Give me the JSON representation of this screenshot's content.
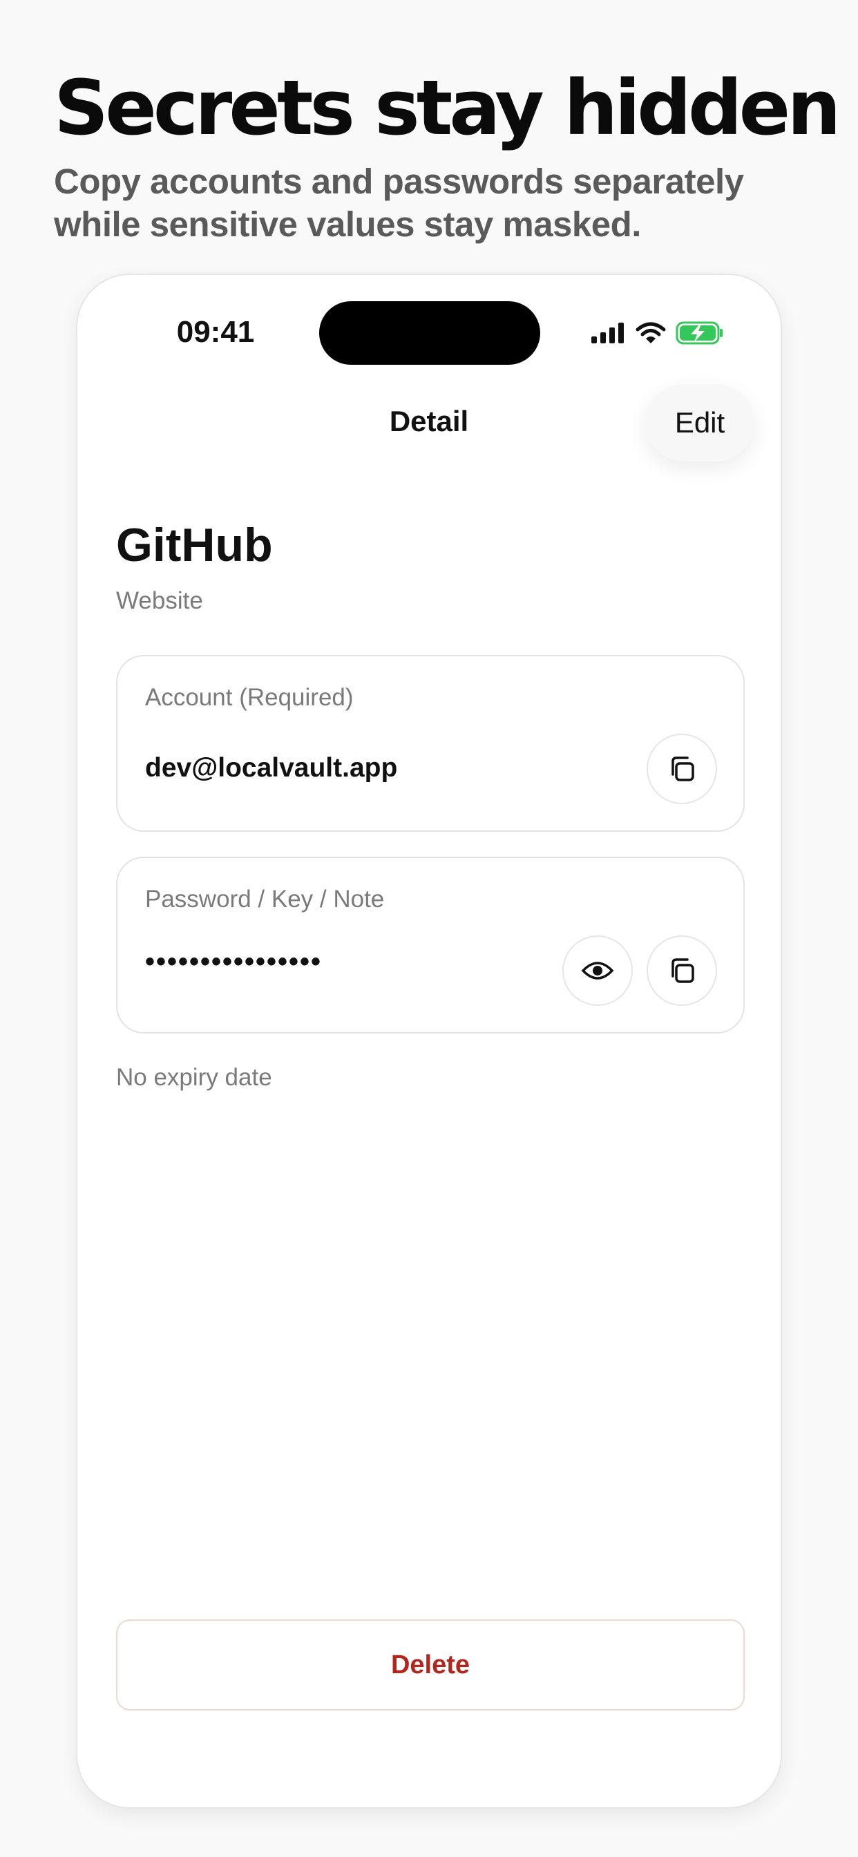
{
  "promo": {
    "headline": "Secrets stay hidden",
    "subheadline": "Copy accounts and passwords separately while sensitive values stay masked."
  },
  "status_bar": {
    "time": "09:41",
    "icons": [
      "cellular-signal-icon",
      "wifi-icon",
      "battery-charging-icon"
    ],
    "battery_color": "#34c759"
  },
  "nav": {
    "title": "Detail",
    "edit_label": "Edit"
  },
  "entry": {
    "title": "GitHub",
    "type": "Website"
  },
  "fields": {
    "account": {
      "label": "Account (Required)",
      "value": "dev@localvault.app",
      "icons": [
        "copy-icon"
      ]
    },
    "password": {
      "label": "Password / Key / Note",
      "value": "••••••••••••••••",
      "icons": [
        "eye-icon",
        "copy-icon"
      ]
    }
  },
  "expiry_text": "No expiry date",
  "delete_label": "Delete",
  "colors": {
    "background": "#f9f9f9",
    "card": "#ffffff",
    "secondary_text": "#7a7a7a",
    "destructive": "#b3261e"
  }
}
